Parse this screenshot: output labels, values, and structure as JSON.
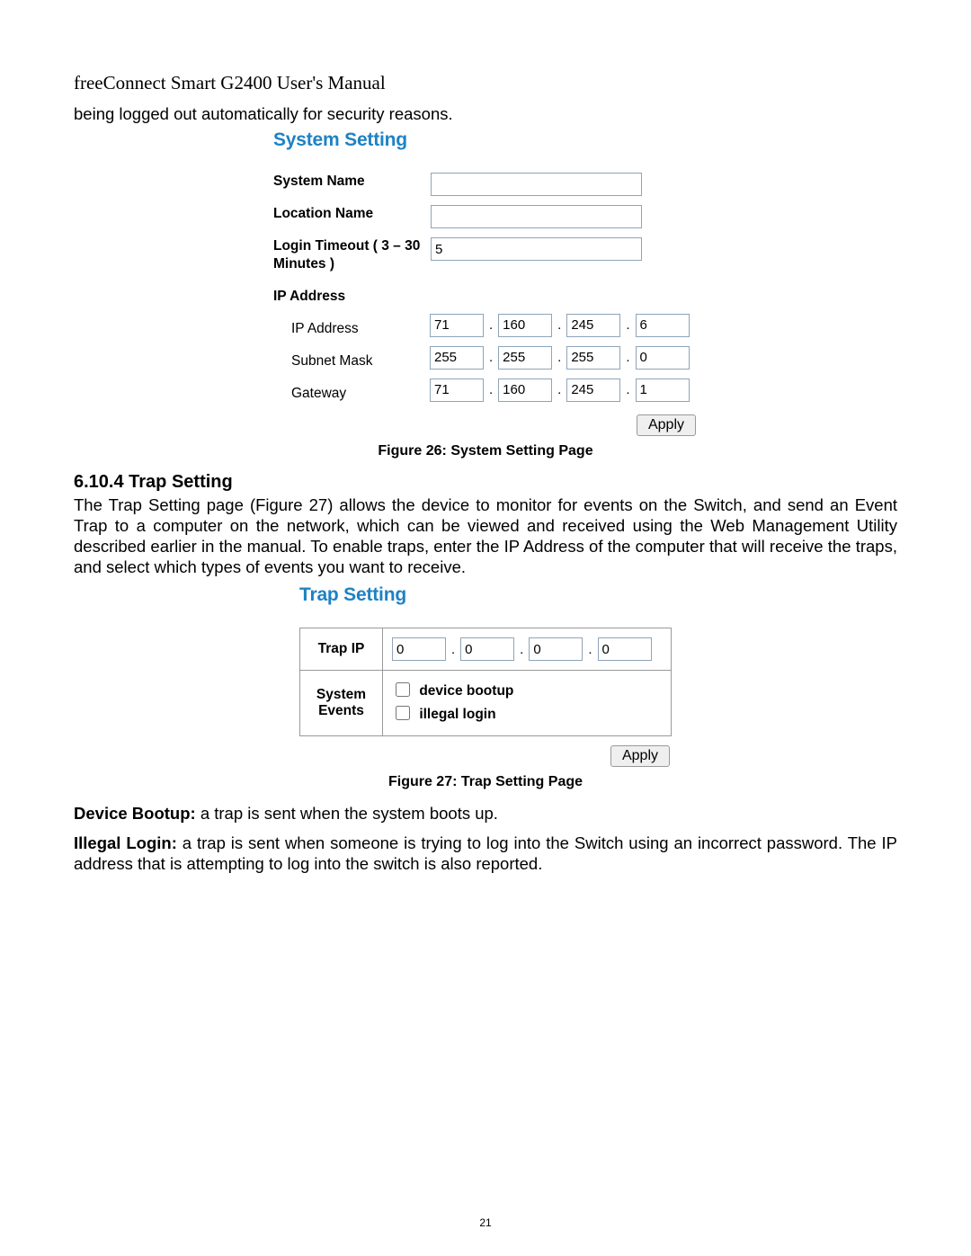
{
  "header": {
    "manual_title": "freeConnect Smart G2400 User's Manual"
  },
  "intro_fragment": "being logged out automatically for security reasons.",
  "figure26": {
    "ui_title": "System Setting",
    "labels": {
      "system_name": "System Name",
      "location_name": "Location Name",
      "login_timeout": "Login Timeout ( 3 – 30 Minutes )",
      "ip_address_section": "IP Address",
      "ip_address": "IP Address",
      "subnet_mask": "Subnet Mask",
      "gateway": "Gateway"
    },
    "values": {
      "system_name": "",
      "location_name": "",
      "login_timeout": "5",
      "ip": [
        "71",
        "160",
        "245",
        "6"
      ],
      "subnet": [
        "255",
        "255",
        "255",
        "0"
      ],
      "gateway": [
        "71",
        "160",
        "245",
        "1"
      ]
    },
    "apply_label": "Apply",
    "caption": "Figure 26: System Setting Page"
  },
  "section": {
    "heading": "6.10.4 Trap Setting",
    "paragraph": "The Trap Setting page (Figure 27) allows the device to monitor for events on the Switch, and send an Event Trap to a computer on the network, which can be viewed and received using the Web Management Utility described earlier in the manual.  To enable traps, enter the IP Address of the computer that will receive the traps, and select which types of events you want to receive."
  },
  "figure27": {
    "ui_title": "Trap Setting",
    "labels": {
      "trap_ip": "Trap IP",
      "system_events": "System Events",
      "device_bootup": "device bootup",
      "illegal_login": "illegal login"
    },
    "values": {
      "trap_ip": [
        "0",
        "0",
        "0",
        "0"
      ],
      "device_bootup_checked": false,
      "illegal_login_checked": false
    },
    "apply_label": "Apply",
    "caption": "Figure 27: Trap Setting Page"
  },
  "definitions": {
    "device_bootup_label": "Device Bootup:",
    "device_bootup_text": " a trap is sent when the system boots up.",
    "illegal_login_label": "Illegal Login:",
    "illegal_login_text": " a trap is sent when someone is trying to log into the Switch using an incorrect password.  The IP address that is attempting to log into the switch is also reported."
  },
  "page_number": "21"
}
